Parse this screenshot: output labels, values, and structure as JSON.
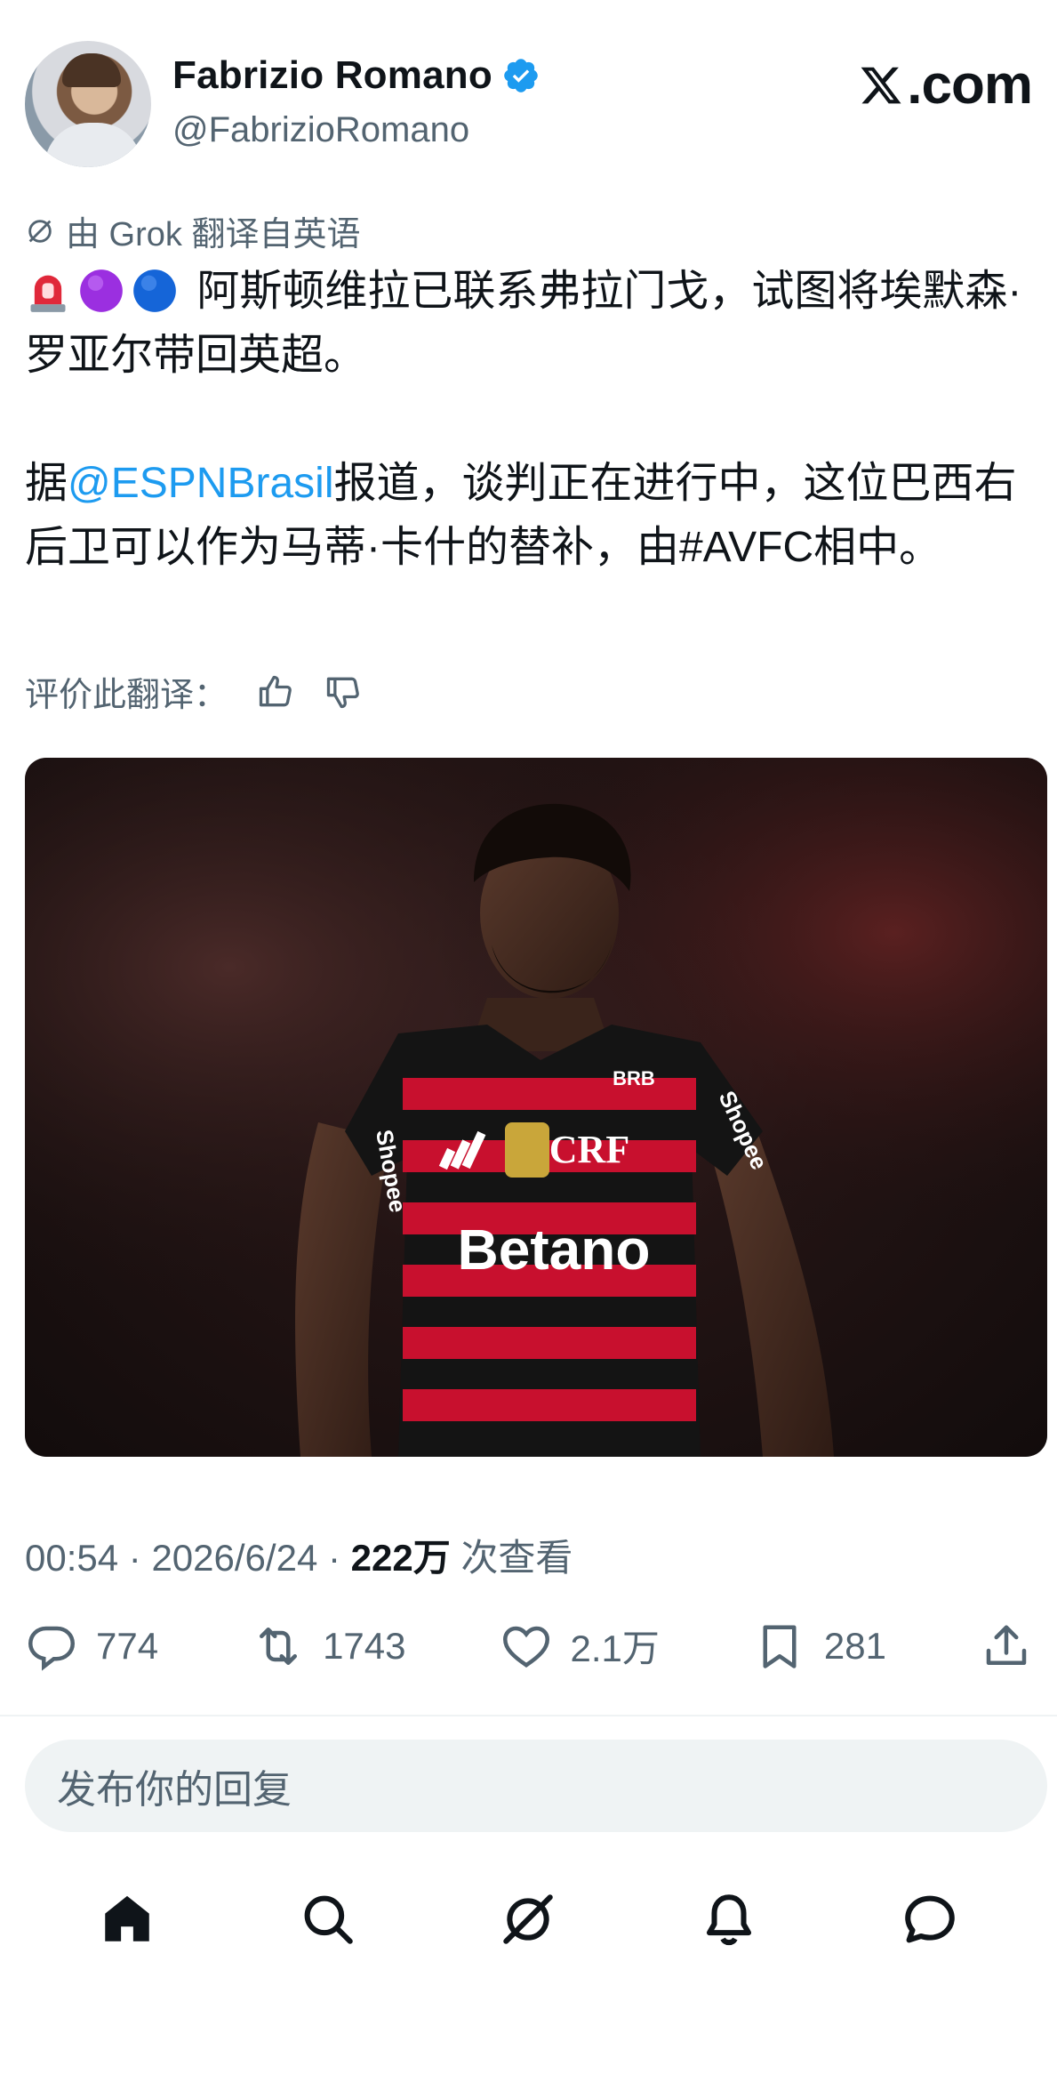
{
  "author": {
    "name": "Fabrizio Romano",
    "handle": "@FabrizioRomano",
    "verified": true
  },
  "brand": {
    "logo_text": ".com"
  },
  "translation": {
    "note": "由 Grok 翻译自英语",
    "rate_label": "评价此翻译："
  },
  "tweet": {
    "paragraph1": "阿斯顿维拉已联系弗拉门戈，试图将埃默森·罗亚尔带回英超。",
    "paragraph2_prefix": "据",
    "mention": "@ESPNBrasil",
    "paragraph2_suffix": "报道，谈判正在进行中，这位巴西右后卫可以作为马蒂·卡什的替补，由#AVFC相中。",
    "emojis": [
      "siren-emoji",
      "purple-circle-emoji",
      "blue-circle-emoji"
    ]
  },
  "photo": {
    "shirt_sponsor": "Betano",
    "sleeve_sponsor": "Shopee",
    "collar_sponsor": "BRB",
    "crest_letters": "CRF"
  },
  "meta": {
    "time": "00:54",
    "date": "2026/6/24",
    "separator": "·",
    "views": "222万",
    "views_label": "次查看"
  },
  "stats": {
    "replies": "774",
    "reposts": "1743",
    "likes": "2.1万",
    "bookmarks": "281"
  },
  "reply_box": {
    "placeholder": "发布你的回复"
  },
  "colors": {
    "accent": "#1d9bf0",
    "secondary_text": "#536471",
    "primary_text": "#0f1419",
    "flamengo_red": "#c8102e"
  }
}
